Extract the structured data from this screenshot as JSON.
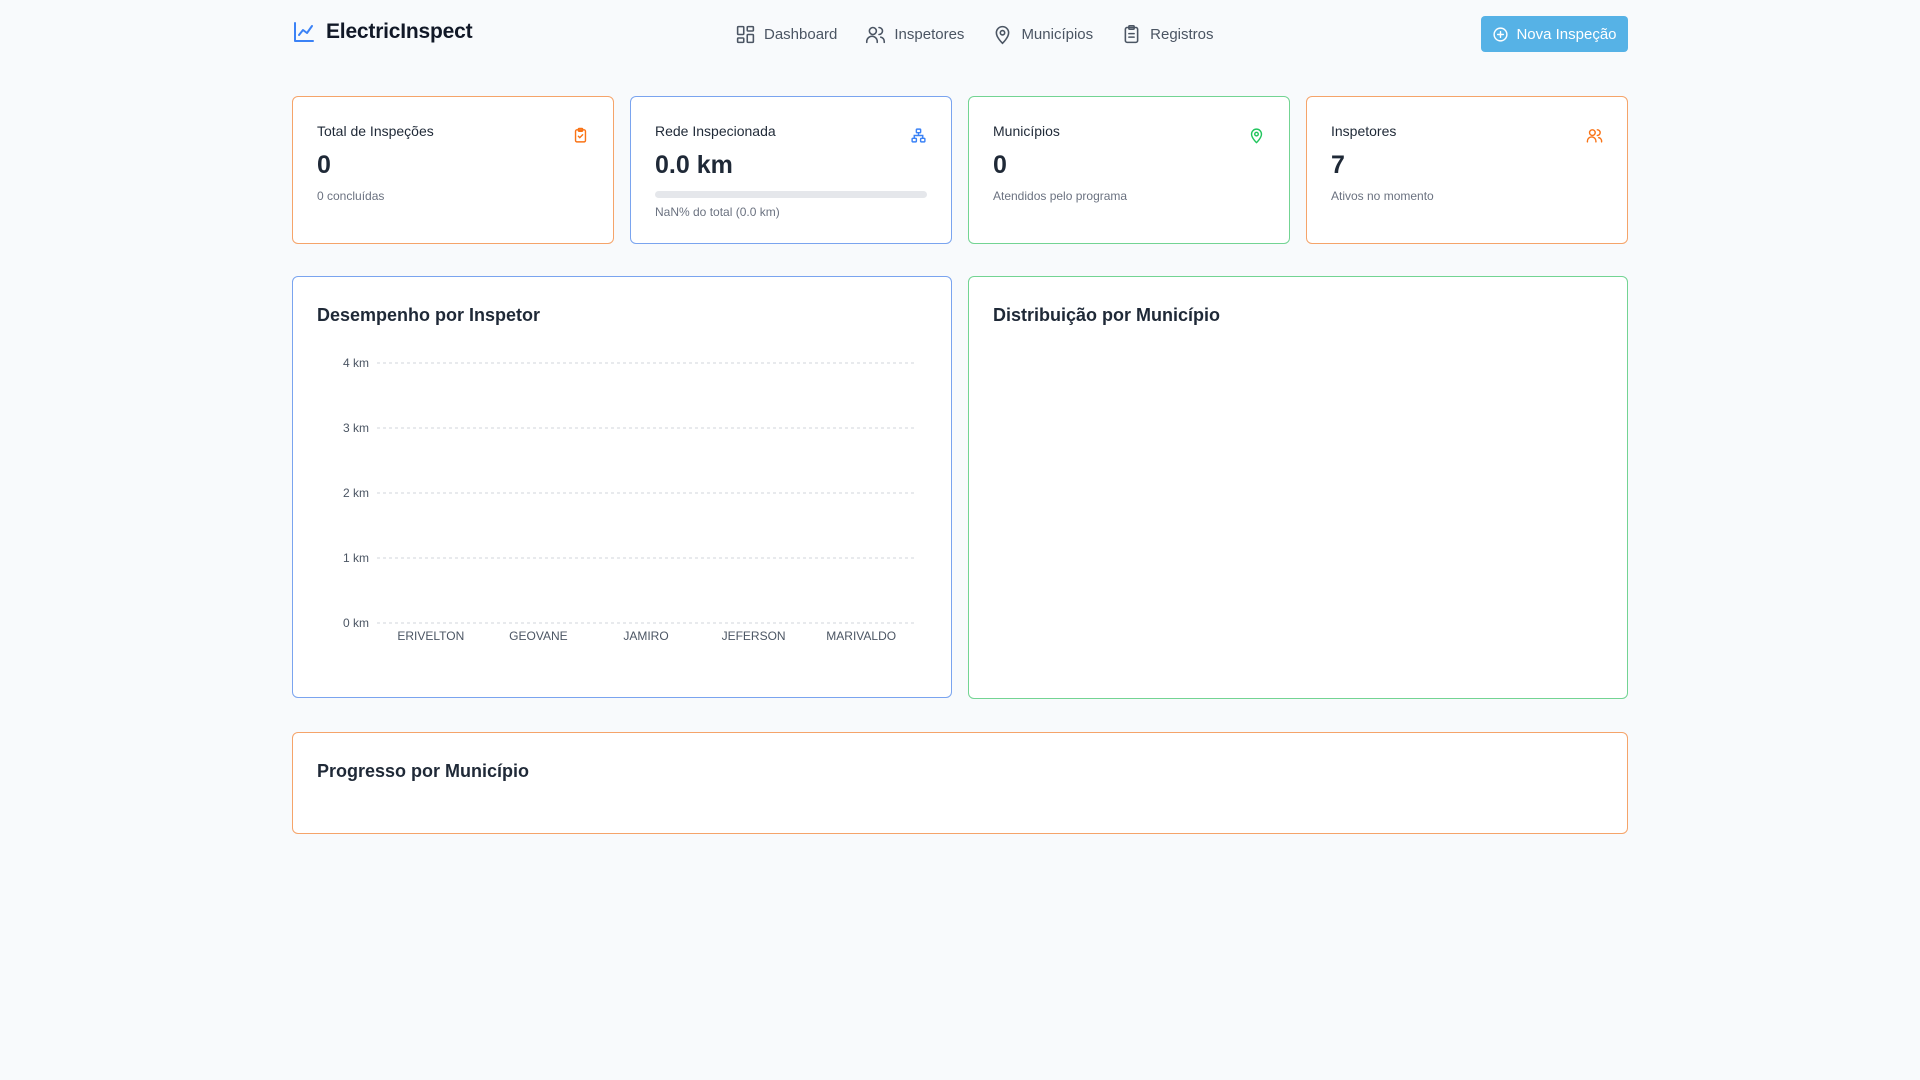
{
  "app": {
    "name": "ElectricInspect"
  },
  "nav": [
    {
      "label": "Dashboard",
      "icon": "dashboard-grid-icon"
    },
    {
      "label": "Inspetores",
      "icon": "users-icon"
    },
    {
      "label": "Municípios",
      "icon": "map-pin-icon"
    },
    {
      "label": "Registros",
      "icon": "clipboard-icon"
    }
  ],
  "new_button": {
    "label": "Nova Inspeção",
    "icon": "plus-circle-icon"
  },
  "colors": {
    "accent": "#56b2e6",
    "orange": "#f97316",
    "blue": "#3b82f6",
    "green": "#22c55e"
  },
  "stats": {
    "total": {
      "title": "Total de Inspeções",
      "value": "0",
      "sub": "0 concluídas",
      "icon": "clipboard-check-icon"
    },
    "network": {
      "title": "Rede Inspecionada",
      "value": "0.0 km",
      "sub": "NaN% do total (0.0 km)",
      "progress": 0,
      "icon": "network-icon"
    },
    "municipios": {
      "title": "Municípios",
      "value": "0",
      "sub": "Atendidos pelo programa",
      "icon": "map-pin-icon"
    },
    "inspetores": {
      "title": "Inspetores",
      "value": "7",
      "sub": "Ativos no momento",
      "icon": "users-icon"
    }
  },
  "panels": {
    "performance": {
      "title": "Desempenho por Inspetor"
    },
    "distribution": {
      "title": "Distribuição por Município"
    },
    "progress": {
      "title": "Progresso por Município"
    }
  },
  "chart_data": {
    "type": "bar",
    "categories": [
      "ERIVELTON",
      "GEOVANE",
      "JAMIRO",
      "JEFERSON",
      "MARIVALDO"
    ],
    "values": [
      0,
      0,
      0,
      0,
      0
    ],
    "ylim": [
      0,
      4
    ],
    "yticks": [
      0,
      1,
      2,
      3,
      4
    ],
    "ytick_labels": [
      "0 km",
      "1 km",
      "2 km",
      "3 km",
      "4 km"
    ],
    "grid": true
  }
}
